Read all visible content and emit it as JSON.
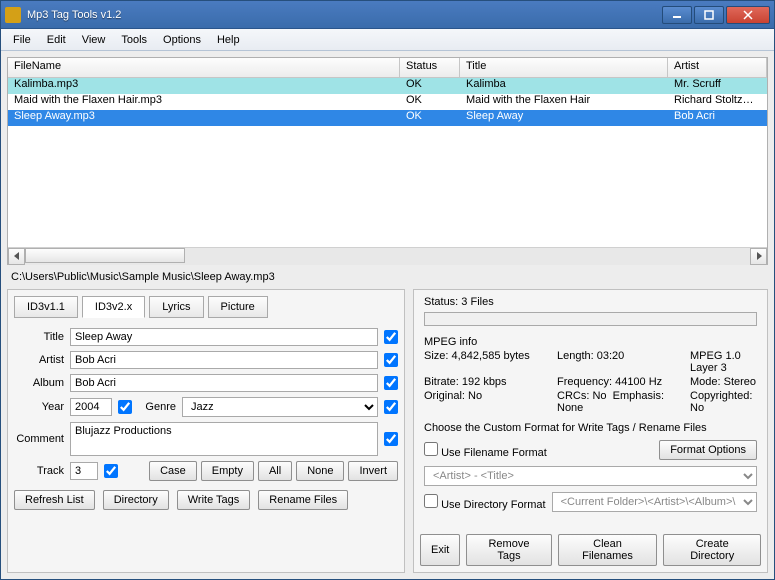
{
  "window": {
    "title": "Mp3 Tag Tools v1.2"
  },
  "menu": [
    "File",
    "Edit",
    "View",
    "Tools",
    "Options",
    "Help"
  ],
  "columns": {
    "filename": "FileName",
    "status": "Status",
    "title": "Title",
    "artist": "Artist"
  },
  "rows": [
    {
      "filename": "Kalimba.mp3",
      "status": "OK",
      "title": "Kalimba",
      "artist": "Mr. Scruff",
      "state": "highlighted"
    },
    {
      "filename": "Maid with the Flaxen Hair.mp3",
      "status": "OK",
      "title": "Maid with the Flaxen Hair",
      "artist": "Richard Stoltzman/Slovak",
      "state": ""
    },
    {
      "filename": "Sleep Away.mp3",
      "status": "OK",
      "title": "Sleep Away",
      "artist": "Bob Acri",
      "state": "selected"
    }
  ],
  "path": "C:\\Users\\Public\\Music\\Sample Music\\Sleep Away.mp3",
  "tabs": [
    "ID3v1.1",
    "ID3v2.x",
    "Lyrics",
    "Picture"
  ],
  "activeTab": 1,
  "form": {
    "titleLabel": "Title",
    "title": "Sleep Away",
    "artistLabel": "Artist",
    "artist": "Bob Acri",
    "albumLabel": "Album",
    "album": "Bob Acri",
    "yearLabel": "Year",
    "year": "2004",
    "genreLabel": "Genre",
    "genre": "Jazz",
    "commentLabel": "Comment",
    "comment": "Blujazz Productions",
    "trackLabel": "Track",
    "track": "3",
    "caseBtn": "Case",
    "emptyBtn": "Empty",
    "allBtn": "All",
    "noneBtn": "None",
    "invertBtn": "Invert"
  },
  "leftBottom": {
    "refresh": "Refresh List",
    "directory": "Directory",
    "writeTags": "Write Tags",
    "renameFiles": "Rename Files"
  },
  "status": {
    "label": "Status: 3 Files"
  },
  "mpeg": {
    "header": "MPEG info",
    "size": "Size: 4,842,585 bytes",
    "length": "Length:  03:20",
    "layer": "MPEG 1.0 Layer 3",
    "bitrate": "Bitrate: 192 kbps",
    "freq": "Frequency: 44100 Hz",
    "mode": "Mode: Stereo",
    "original": "Original: No",
    "crc": "CRCs: No",
    "emphasis": "Emphasis: None",
    "copyright": "Copyrighted: No"
  },
  "custom": {
    "header": "Choose the Custom Format for Write Tags / Rename Files",
    "useFilename": "Use Filename Format",
    "formatOptions": "Format Options",
    "filenameFmt": "<Artist> - <Title>",
    "useDirectory": "Use Directory Format",
    "directoryFmt": "<Current Folder>\\<Artist>\\<Album>\\"
  },
  "rightBottom": {
    "exit": "Exit",
    "removeTags": "Remove Tags",
    "cleanFilenames": "Clean Filenames",
    "createDirectory": "Create Directory"
  }
}
